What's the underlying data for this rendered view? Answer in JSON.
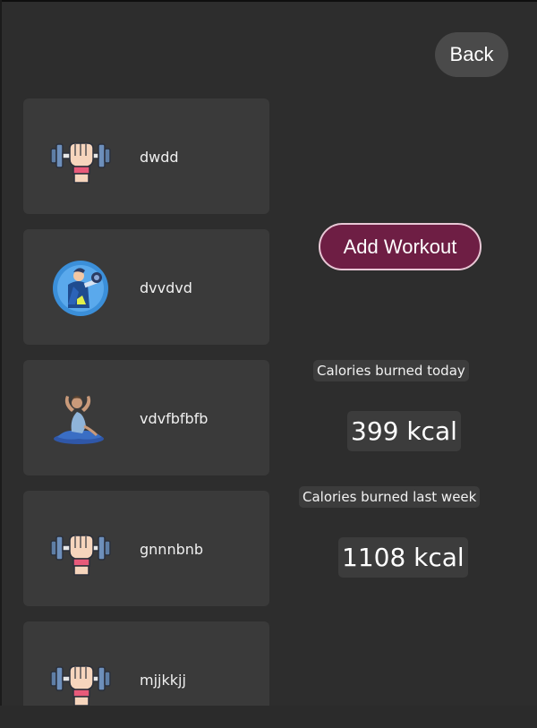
{
  "header": {
    "back_label": "Back"
  },
  "workouts": [
    {
      "name": "dwdd",
      "icon": "dumbbell-fist-icon"
    },
    {
      "name": "dvvdvd",
      "icon": "weightlifter-avatar-icon"
    },
    {
      "name": "vdvfbfbfb",
      "icon": "yoga-pose-icon"
    },
    {
      "name": "gnnnbnb",
      "icon": "dumbbell-fist-icon"
    },
    {
      "name": "mjjkkjj",
      "icon": "dumbbell-fist-icon"
    }
  ],
  "actions": {
    "add_workout_label": "Add Workout"
  },
  "stats": {
    "today_label": "Calories burned today",
    "today_value": "399 kcal",
    "week_label": "Calories burned last week",
    "week_value": "1108 kcal"
  },
  "colors": {
    "background": "#2d2d2d",
    "card": "#3a3a3a",
    "accent": "#6e1e44",
    "accent_border": "#e8c7d5"
  }
}
